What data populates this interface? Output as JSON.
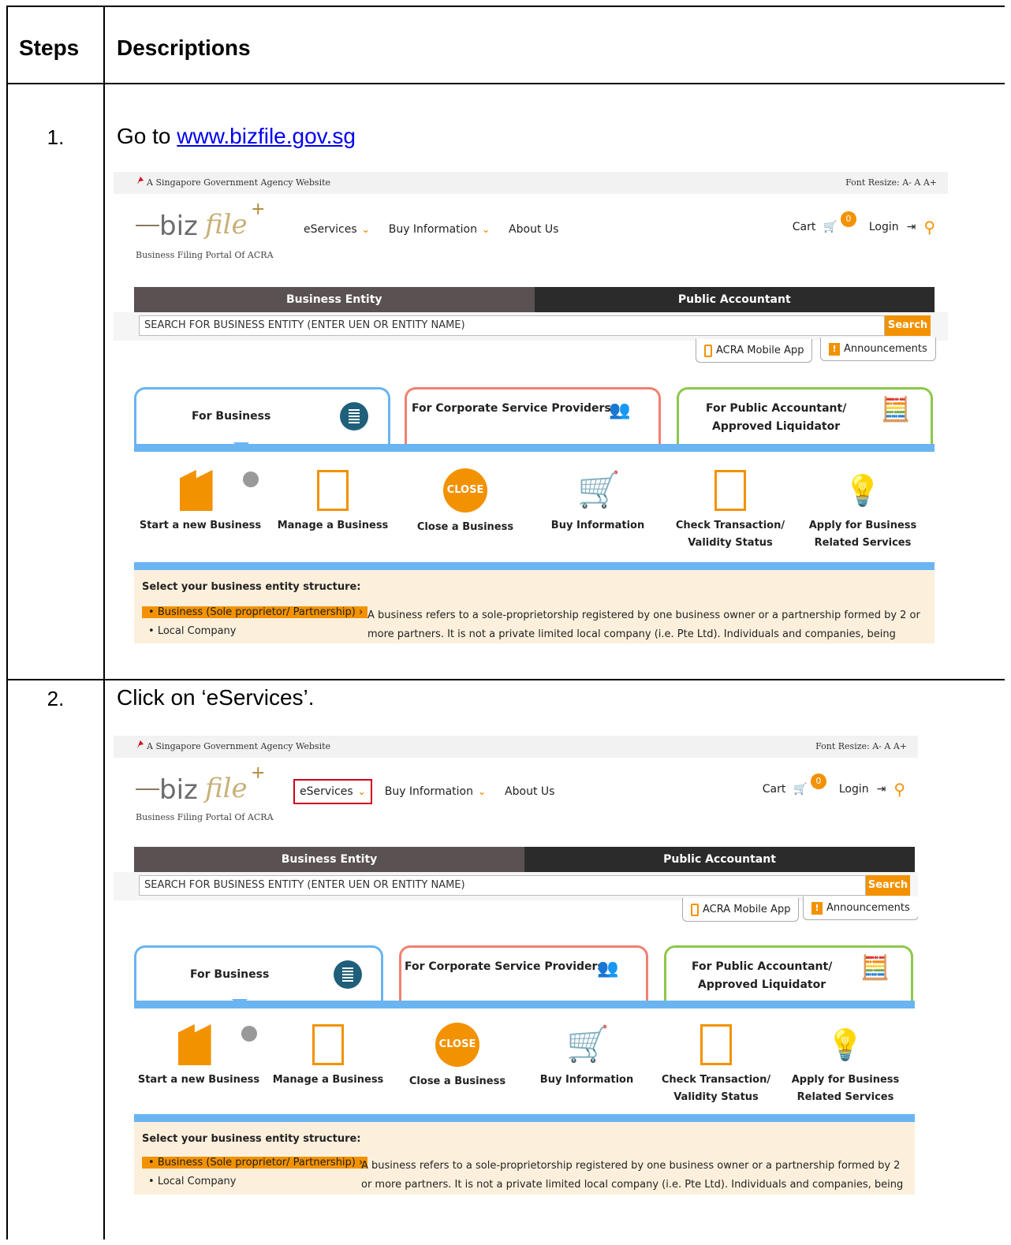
{
  "table": {
    "header_steps": "Steps",
    "header_descriptions": "Descriptions",
    "rows": [
      {
        "number": "1.",
        "text_prefix": "Go to ",
        "link": "www.bizfile.gov.sg"
      },
      {
        "number": "2.",
        "text": "Click on ‘eServices’."
      }
    ]
  },
  "site": {
    "gov_banner": "A Singapore Government Agency Website",
    "font_resize": "Font Resize: A- A A+",
    "logo_subtitle": "Business Filing Portal Of ACRA",
    "nav": {
      "eservices": "eServices",
      "buy_info": "Buy Information",
      "about": "About Us"
    },
    "cart": "Cart",
    "cart_count": "0",
    "login": "Login",
    "tabs": {
      "business_entity": "Business Entity",
      "public_accountant": "Public Accountant"
    },
    "search_placeholder": "SEARCH FOR BUSINESS ENTITY (ENTER UEN OR ENTITY NAME)",
    "search_button": "Search",
    "mobile_app": "ACRA Mobile App",
    "announcements": "Announcements",
    "cards": {
      "for_business": "For Business",
      "csp": "For Corporate Service Providers",
      "pa_line1": "For Public Accountant/",
      "pa_line2": "Approved Liquidator"
    },
    "services": {
      "start": "Start a new Business",
      "manage": "Manage a Business",
      "close_icon_text": "CLOSE",
      "close": "Close a Business",
      "buy": "Buy Information",
      "check_line1": "Check Transaction/",
      "check_line2": "Validity Status",
      "apply_line1": "Apply for Business",
      "apply_line2": "Related Services"
    },
    "structure_title": "Select your business entity structure:",
    "option_business": "Business (Sole proprietor/ Partnership)",
    "option_local": "Local Company",
    "description": "A business refers to a sole-proprietorship registered by one business owner or a partnership formed by 2 or more partners. It is not a private limited local company (i.e. Pte Ltd). Individuals and companies, being “legal"
  },
  "colors": {
    "accent": "#f39200",
    "highlight_box": "#d0021b",
    "tab_active": "#5a5152",
    "tab_inactive": "#2b2b2b",
    "blue_bar": "#6ab4f2"
  }
}
